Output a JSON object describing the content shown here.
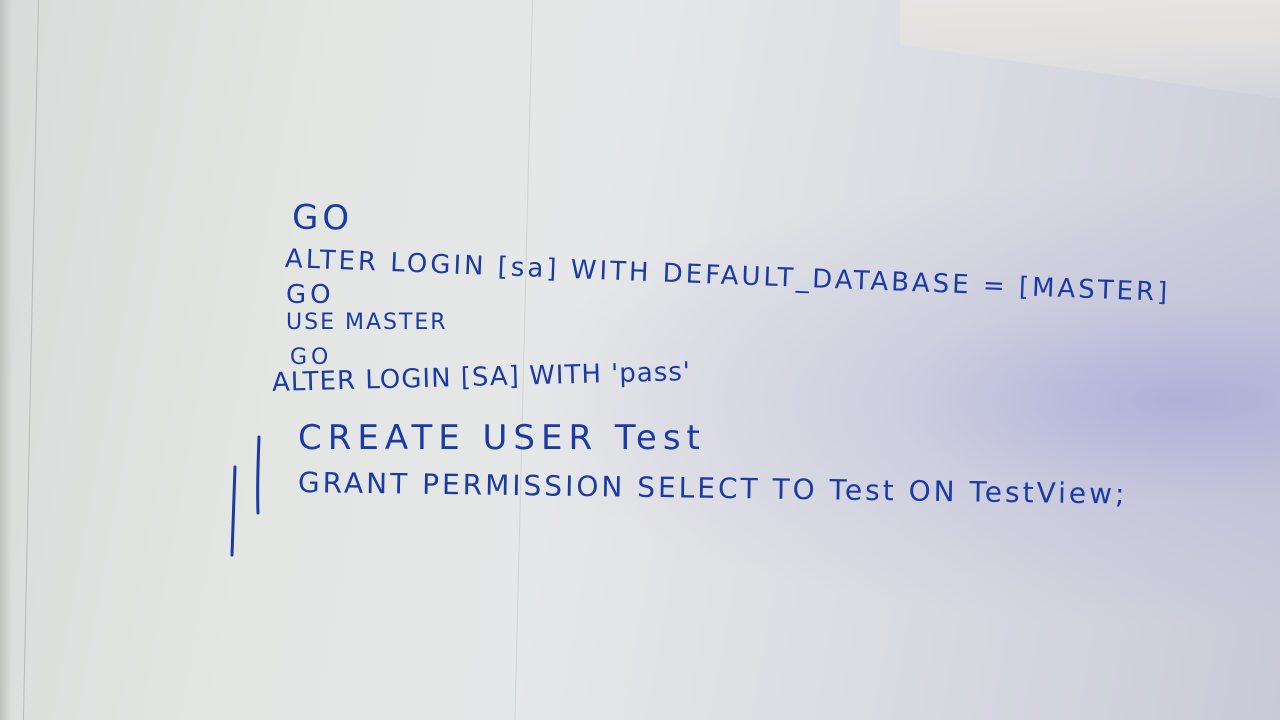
{
  "whiteboard": {
    "lines": [
      "GO",
      "ALTER LOGIN [sa] WITH DEFAULT_DATABASE = [MASTER]",
      "GO",
      "USE MASTER",
      "GO",
      "ALTER LOGIN [SA] WITH 'pass'",
      "CREATE USER Test",
      "GRANT PERMISSION SELECT TO Test ON TestView;"
    ],
    "ink_color": "#1a3aa8",
    "surface_color": "#e4e6e4"
  }
}
